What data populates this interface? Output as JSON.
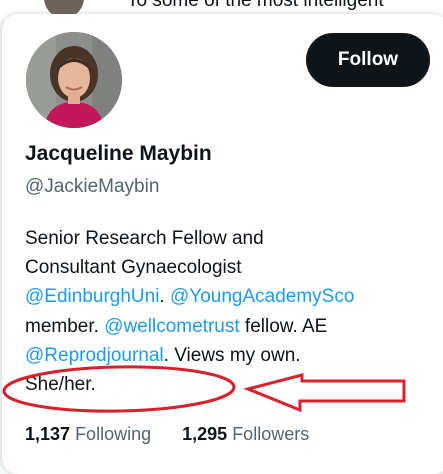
{
  "background": {
    "text": "To some of the most intelligent"
  },
  "profile": {
    "name": "Jacqueline Maybin",
    "handle": "@JackieMaybin",
    "follow_label": "Follow"
  },
  "bio": {
    "line1": "Senior Research Fellow and",
    "line2": "Consultant Gynaecologist",
    "mention_edinburgh": "@EdinburghUni",
    "dot1": ".",
    "mention_young": "@YoungAcademySco",
    "line4_text": "member.",
    "mention_wellcome": "@wellcometrust",
    "line4_tail": "fellow. AE",
    "mention_reprod": "@Reprodjournal",
    "line5_tail": ". Views my own.",
    "line6": "She/her."
  },
  "stats": {
    "following_count": "1,137",
    "following_label": "Following",
    "followers_count": "1,295",
    "followers_label": "Followers"
  },
  "colors": {
    "link": "#1d9bf0",
    "muted": "#536471",
    "button": "#0f1419",
    "annotation": "#d9202c"
  }
}
